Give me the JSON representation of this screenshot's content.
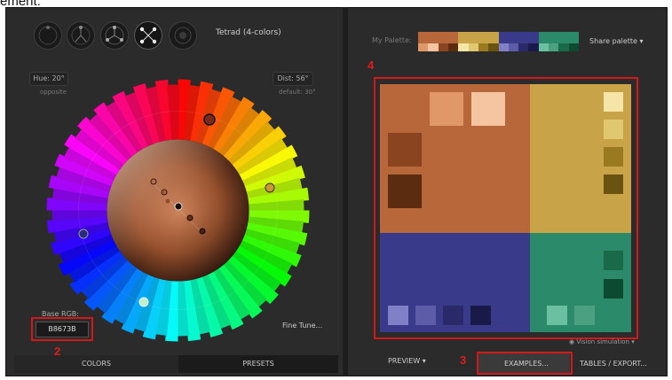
{
  "caption": "ement:",
  "scheme": {
    "title": "Tetrad (4-colors)",
    "buttons": [
      {
        "name": "mono-scheme-button"
      },
      {
        "name": "triad-scheme-button"
      },
      {
        "name": "triad-gap-scheme-button"
      },
      {
        "name": "tetrad-scheme-button"
      },
      {
        "name": "free-scheme-button"
      }
    ]
  },
  "hue": {
    "label": "Hue: 20°",
    "sub": "opposite"
  },
  "dist": {
    "label": "Dist: 56°",
    "sub": "default: 30°"
  },
  "base_rgb": {
    "label": "Base RGB:",
    "value": "B8673B"
  },
  "fine_tune": "Fine Tune...",
  "left_tabs": {
    "colors": "COLORS",
    "presets": "PRESETS"
  },
  "palette": {
    "label": "My Palette:",
    "share": "Share palette",
    "groups": [
      {
        "main": "#b8673b",
        "shades": [
          "#e09868",
          "#f5c4a0",
          "#8a4520",
          "#5c2c10"
        ]
      },
      {
        "main": "#c8a347",
        "shades": [
          "#f5e6a8",
          "#e0c870",
          "#9a7a20",
          "#6a5210"
        ]
      },
      {
        "main": "#3a3a8a",
        "shades": [
          "#8080c8",
          "#5c5ca8",
          "#2a2a6a",
          "#1a1a48"
        ]
      },
      {
        "main": "#2a8a6a",
        "shades": [
          "#6ac0a0",
          "#4aa080",
          "#1a6a4a",
          "#0c4a32"
        ]
      }
    ]
  },
  "preview": {
    "quads": [
      {
        "name": "preview-quad-primary",
        "color": "#b8673b"
      },
      {
        "name": "preview-quad-secondary-1",
        "color": "#c8a347"
      },
      {
        "name": "preview-quad-secondary-2",
        "color": "#3a3a8a"
      },
      {
        "name": "preview-quad-complement",
        "color": "#2a8a6a"
      }
    ],
    "swatches": {
      "primary": [
        "#e09868",
        "#f5c4a0",
        "#8a4520",
        "#5c2c10"
      ],
      "secondary1": [
        "#f5e6a8",
        "#e0c870",
        "#9a7a20",
        "#6a5210"
      ],
      "secondary2": [
        "#8080c8",
        "#5c5ca8",
        "#2a2a6a",
        "#1a1a48"
      ],
      "complement": [
        "#1a6a4a",
        "#0c4a32",
        "#6ac0a0",
        "#4aa080"
      ]
    }
  },
  "vision": "Vision simulation",
  "bottom": {
    "preview": "PREVIEW",
    "examples": "EXAMPLES...",
    "tables": "TABLES / EXPORT..."
  },
  "callouts": {
    "c2": "2",
    "c3": "3",
    "c4": "4"
  },
  "accent": "#d4181a"
}
